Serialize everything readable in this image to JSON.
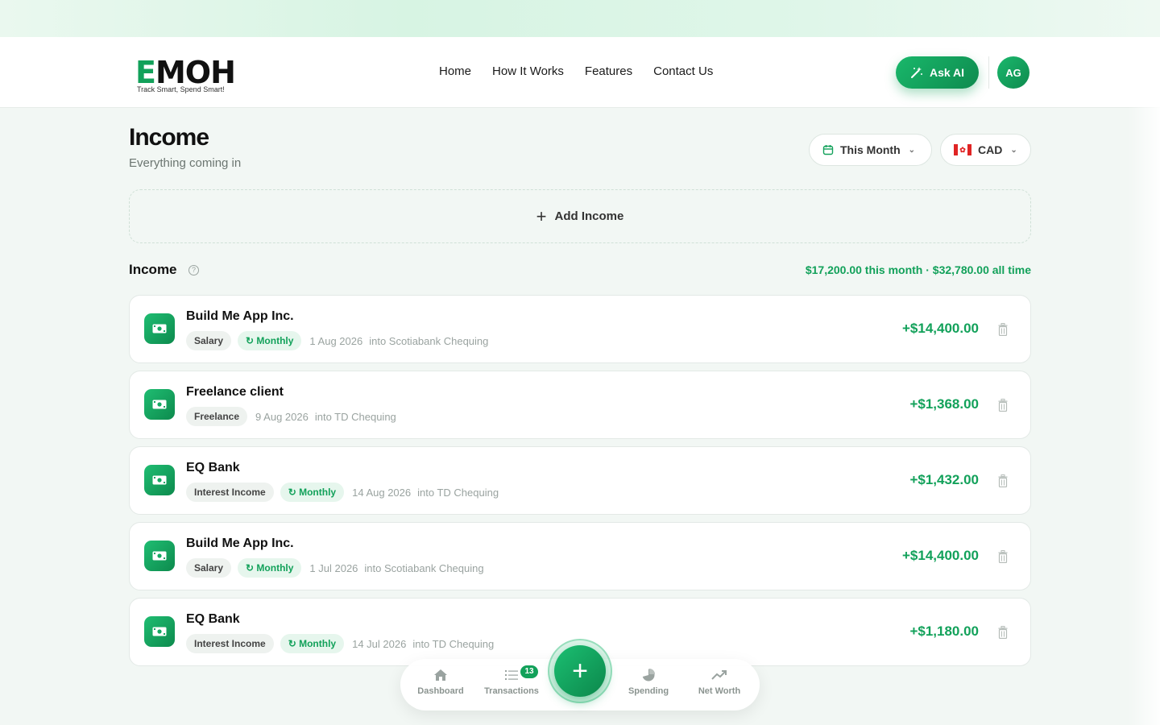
{
  "brand": {
    "logo_text": "EMOH",
    "tagline": "Track Smart, Spend Smart!",
    "accent": "#12a15a"
  },
  "nav": {
    "links": [
      "Home",
      "How It Works",
      "Features",
      "Contact Us"
    ],
    "ask_ai": "Ask AI",
    "avatar_initials": "AG"
  },
  "page": {
    "title": "Income",
    "subtitle": "Everything coming in"
  },
  "filters": {
    "period": "This Month",
    "currency": "CAD"
  },
  "add_income": "Add Income",
  "section": {
    "title": "Income",
    "summary": "$17,200.00 this month · $32,780.00 all time"
  },
  "rows": [
    {
      "name": "Build Me App Inc.",
      "category": "Salary",
      "recurrence": "Monthly",
      "date": "1 Aug 2026",
      "account": "into Scotiabank Chequing",
      "amount": "+$14,400.00"
    },
    {
      "name": "Freelance client",
      "category": "Freelance",
      "recurrence": "",
      "date": "9 Aug 2026",
      "account": "into TD Chequing",
      "amount": "+$1,368.00"
    },
    {
      "name": "EQ Bank",
      "category": "Interest Income",
      "recurrence": "Monthly",
      "date": "14 Aug 2026",
      "account": "into TD Chequing",
      "amount": "+$1,432.00"
    },
    {
      "name": "Build Me App Inc.",
      "category": "Salary",
      "recurrence": "Monthly",
      "date": "1 Jul 2026",
      "account": "into Scotiabank Chequing",
      "amount": "+$14,400.00"
    },
    {
      "name": "EQ Bank",
      "category": "Interest Income",
      "recurrence": "Monthly",
      "date": "14 Jul 2026",
      "account": "into TD Chequing",
      "amount": "+$1,180.00"
    }
  ],
  "bottom_nav": {
    "dashboard": "Dashboard",
    "transactions": "Transactions",
    "transactions_badge": "13",
    "spending": "Spending",
    "net_worth": "Net Worth"
  }
}
